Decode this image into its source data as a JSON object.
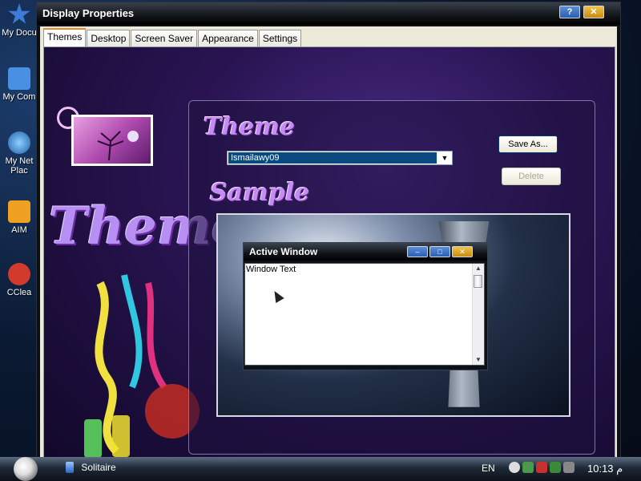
{
  "desktop": {
    "icons": [
      {
        "label": "My Docu",
        "color": "#3e7bd6"
      },
      {
        "label": "My Com",
        "color": "#4a90e2"
      },
      {
        "label": "My Net Plac",
        "color": "#3a86c8"
      },
      {
        "label": "AIM",
        "color": "#f0a020"
      },
      {
        "label": "CClea",
        "color": "#d23b2b"
      }
    ]
  },
  "window": {
    "title": "Display Properties",
    "help_label": "?",
    "close_label": "✕",
    "tabs": [
      "Themes",
      "Desktop",
      "Screen Saver",
      "Appearance",
      "Settings"
    ],
    "active_tab": "Themes"
  },
  "themes_panel": {
    "art_word": "Themes",
    "theme_heading": "Theme",
    "sample_heading": "Sample",
    "selected_theme": "Ismailawy09",
    "save_as_label": "Save As...",
    "delete_label": "Delete"
  },
  "sample": {
    "window_title": "Active Window",
    "window_text": "Window Text",
    "min_label": "–",
    "max_label": "□",
    "close_label": "✕"
  },
  "taskbar": {
    "task": "Solitaire",
    "language": "EN",
    "time": "10:13 م"
  },
  "colors": {
    "accent_purple": "#c68cf5",
    "selection_blue": "#0b4a7e"
  }
}
